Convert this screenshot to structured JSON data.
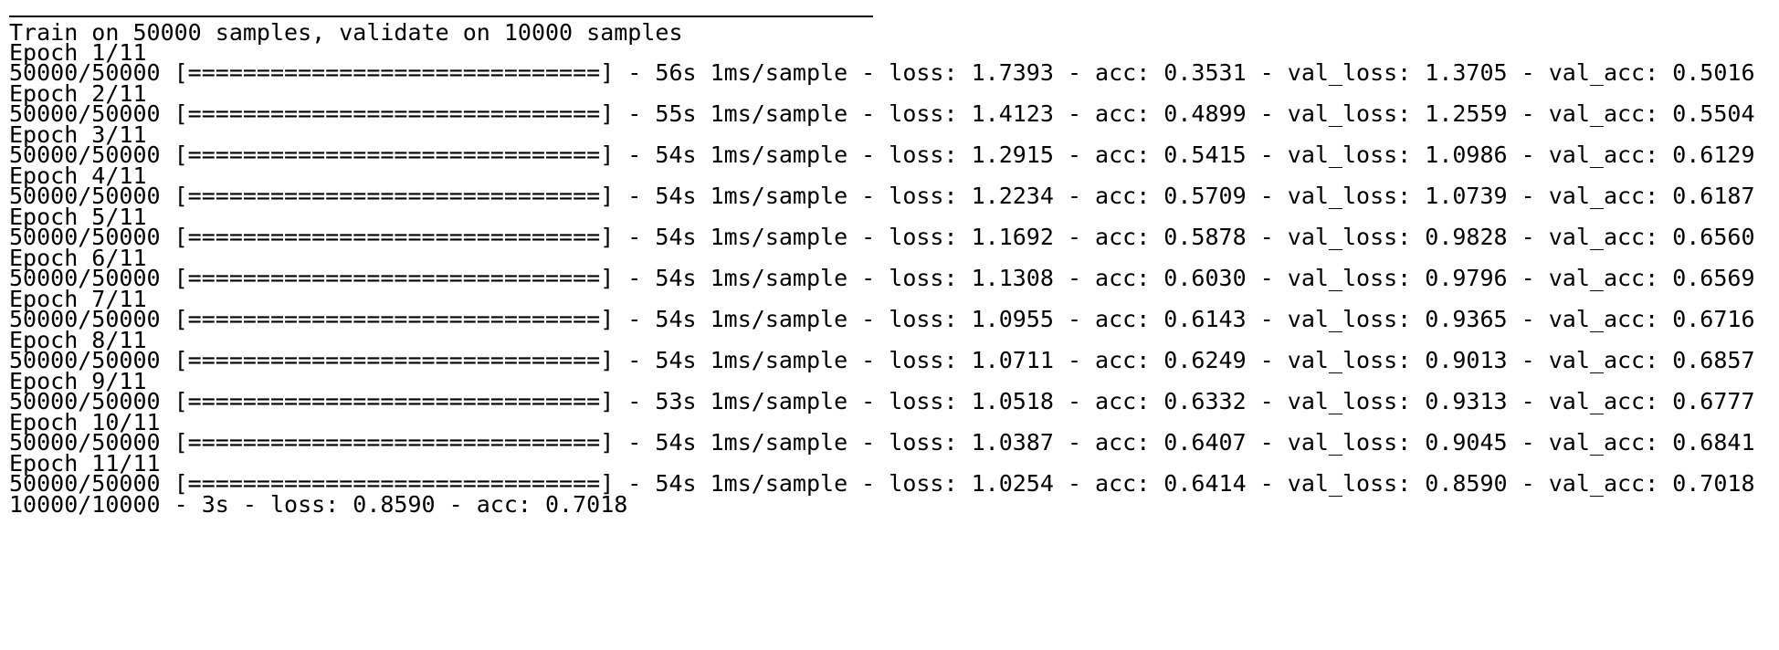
{
  "log": {
    "train_info": "Train on 50000 samples, validate on 10000 samples",
    "epochs": [
      {
        "header": "Epoch 1/11",
        "progress": "50000/50000 [==============================] - 56s 1ms/sample - loss: 1.7393 - acc: 0.3531 - val_loss: 1.3705 - val_acc: 0.5016"
      },
      {
        "header": "Epoch 2/11",
        "progress": "50000/50000 [==============================] - 55s 1ms/sample - loss: 1.4123 - acc: 0.4899 - val_loss: 1.2559 - val_acc: 0.5504"
      },
      {
        "header": "Epoch 3/11",
        "progress": "50000/50000 [==============================] - 54s 1ms/sample - loss: 1.2915 - acc: 0.5415 - val_loss: 1.0986 - val_acc: 0.6129"
      },
      {
        "header": "Epoch 4/11",
        "progress": "50000/50000 [==============================] - 54s 1ms/sample - loss: 1.2234 - acc: 0.5709 - val_loss: 1.0739 - val_acc: 0.6187"
      },
      {
        "header": "Epoch 5/11",
        "progress": "50000/50000 [==============================] - 54s 1ms/sample - loss: 1.1692 - acc: 0.5878 - val_loss: 0.9828 - val_acc: 0.6560"
      },
      {
        "header": "Epoch 6/11",
        "progress": "50000/50000 [==============================] - 54s 1ms/sample - loss: 1.1308 - acc: 0.6030 - val_loss: 0.9796 - val_acc: 0.6569"
      },
      {
        "header": "Epoch 7/11",
        "progress": "50000/50000 [==============================] - 54s 1ms/sample - loss: 1.0955 - acc: 0.6143 - val_loss: 0.9365 - val_acc: 0.6716"
      },
      {
        "header": "Epoch 8/11",
        "progress": "50000/50000 [==============================] - 54s 1ms/sample - loss: 1.0711 - acc: 0.6249 - val_loss: 0.9013 - val_acc: 0.6857"
      },
      {
        "header": "Epoch 9/11",
        "progress": "50000/50000 [==============================] - 53s 1ms/sample - loss: 1.0518 - acc: 0.6332 - val_loss: 0.9313 - val_acc: 0.6777"
      },
      {
        "header": "Epoch 10/11",
        "progress": "50000/50000 [==============================] - 54s 1ms/sample - loss: 1.0387 - acc: 0.6407 - val_loss: 0.9045 - val_acc: 0.6841"
      },
      {
        "header": "Epoch 11/11",
        "progress": "50000/50000 [==============================] - 54s 1ms/sample - loss: 1.0254 - acc: 0.6414 - val_loss: 0.8590 - val_acc: 0.7018"
      }
    ],
    "eval_result": "10000/10000 - 3s - loss: 0.8590 - acc: 0.7018"
  },
  "colors": {
    "background": "#ffffff",
    "text": "#000000"
  }
}
